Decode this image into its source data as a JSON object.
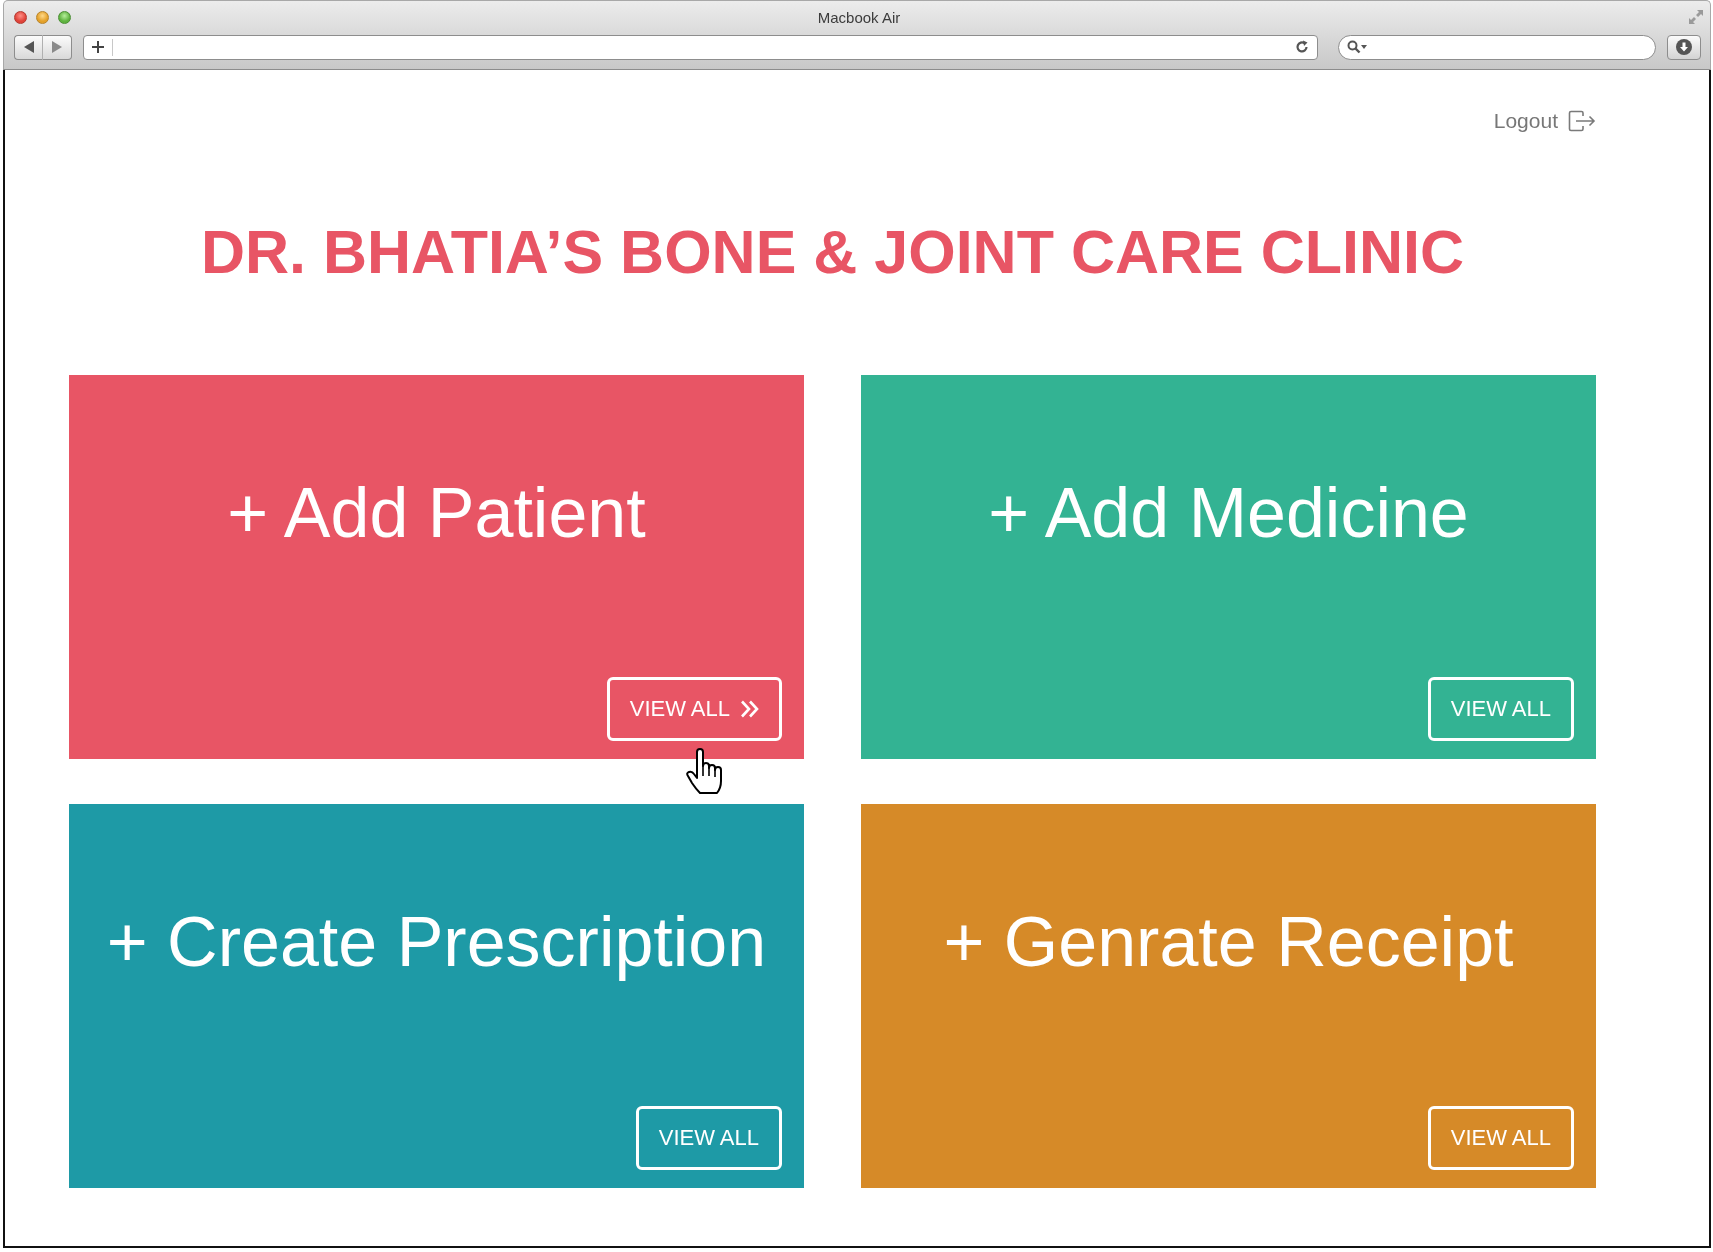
{
  "window": {
    "title": "Macbook Air"
  },
  "header": {
    "logout": "Logout"
  },
  "clinic_title": "DR. BHATIA’S BONE & JOINT CARE CLINIC",
  "tiles": [
    {
      "label": "+ Add Patient",
      "color": "#e85565",
      "button": "VIEW ALL",
      "hovered": true
    },
    {
      "label": "+ Add Medicine",
      "color": "#33b393",
      "button": "VIEW ALL",
      "hovered": false
    },
    {
      "label": "+ Create Prescription",
      "color": "#1e9aa6",
      "button": "VIEW ALL",
      "hovered": false
    },
    {
      "label": "+ Genrate Receipt",
      "color": "#d68a28",
      "button": "VIEW ALL",
      "hovered": false
    }
  ]
}
